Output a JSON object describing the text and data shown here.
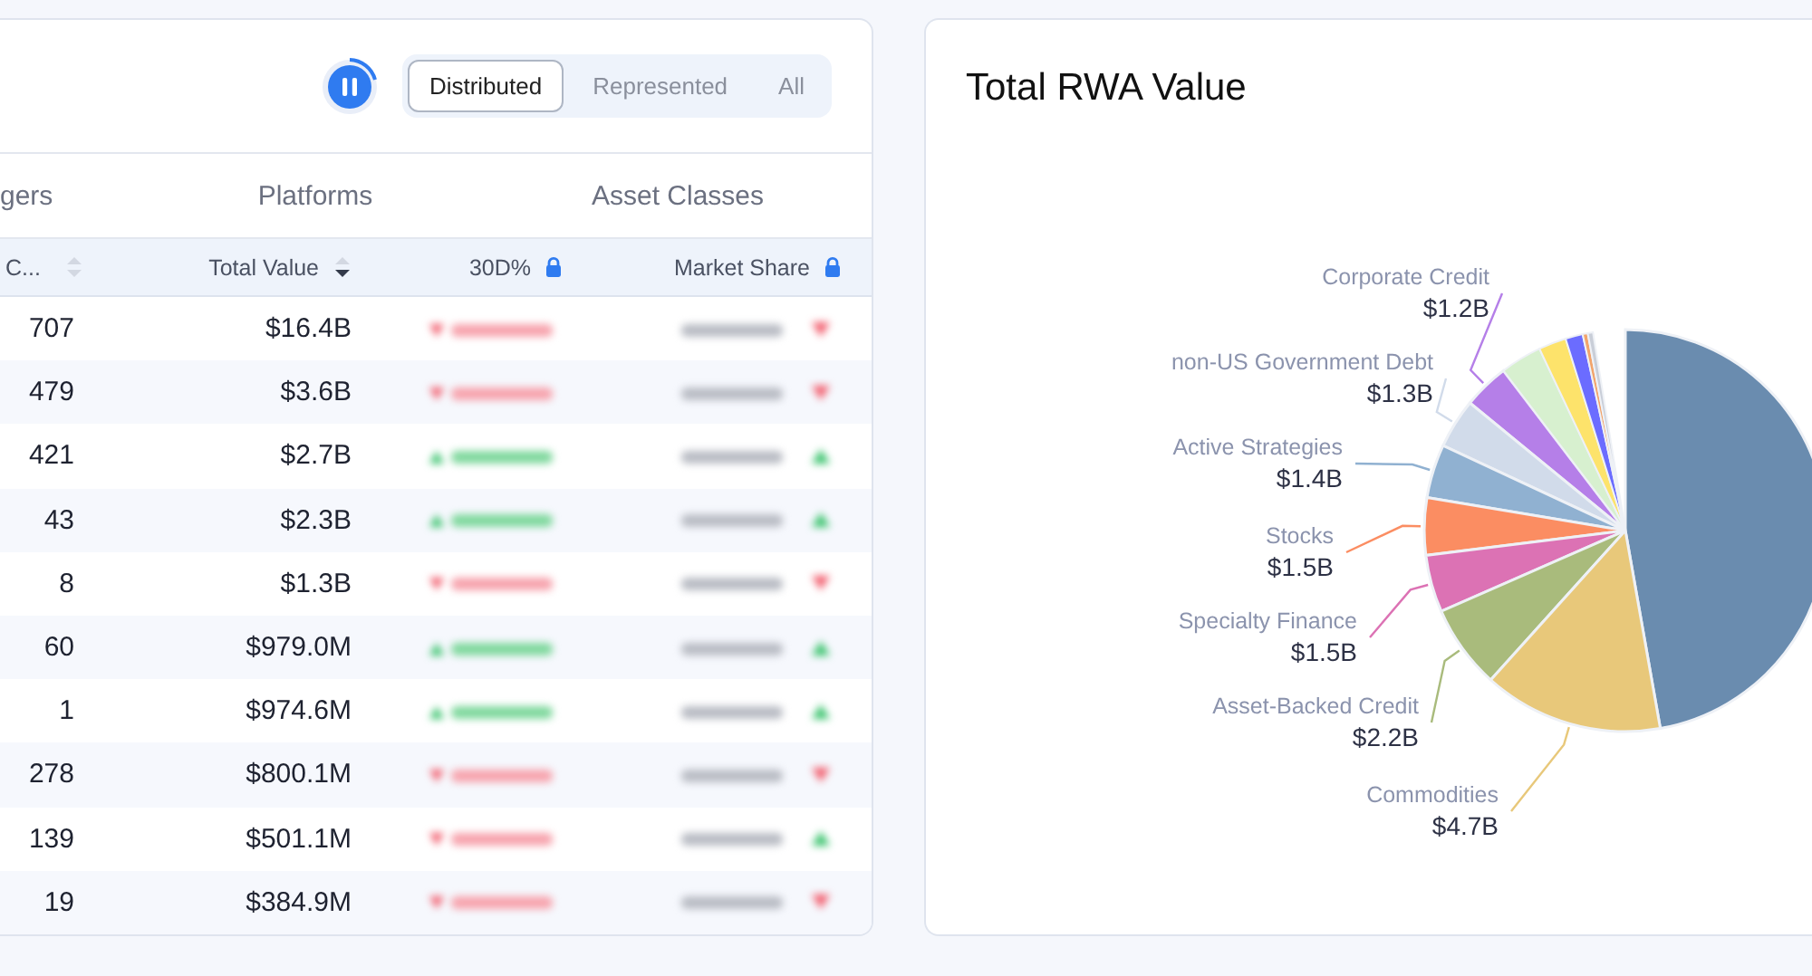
{
  "controls": {
    "segments": [
      {
        "label": "Distributed",
        "selected": true
      },
      {
        "label": "Represented",
        "selected": false
      },
      {
        "label": "All",
        "selected": false
      }
    ],
    "playing": true
  },
  "tabs": [
    {
      "label": "gers"
    },
    {
      "label": "Platforms"
    },
    {
      "label": "Asset Classes"
    }
  ],
  "table": {
    "columns": [
      {
        "label": "C...",
        "sorted": false,
        "locked": false
      },
      {
        "label": "Total Value",
        "sorted": true,
        "locked": false
      },
      {
        "label": "30D%",
        "locked": true
      },
      {
        "label": "Market Share",
        "locked": true
      }
    ],
    "rows": [
      {
        "count": "707",
        "total_value": "$16.4B",
        "change_rising": false,
        "share_rising": false
      },
      {
        "count": "479",
        "total_value": "$3.6B",
        "change_rising": false,
        "share_rising": false
      },
      {
        "count": "421",
        "total_value": "$2.7B",
        "change_rising": true,
        "share_rising": true
      },
      {
        "count": "43",
        "total_value": "$2.3B",
        "change_rising": true,
        "share_rising": true
      },
      {
        "count": "8",
        "total_value": "$1.3B",
        "change_rising": false,
        "share_rising": false
      },
      {
        "count": "60",
        "total_value": "$979.0M",
        "change_rising": true,
        "share_rising": true
      },
      {
        "count": "1",
        "total_value": "$974.6M",
        "change_rising": true,
        "share_rising": true
      },
      {
        "count": "278",
        "total_value": "$800.1M",
        "change_rising": false,
        "share_rising": false
      },
      {
        "count": "139",
        "total_value": "$501.1M",
        "change_rising": false,
        "share_rising": true
      },
      {
        "count": "19",
        "total_value": "$384.9M",
        "change_rising": false,
        "share_rising": false
      }
    ]
  },
  "chart_panel": {
    "title": "Total RWA Value",
    "pie_labels": [
      {
        "name": "Corporate Credit",
        "value": "$1.2B",
        "color": "#b57fe8"
      },
      {
        "name": "non-US Government Debt",
        "value": "$1.3B",
        "color": "#d1dbea"
      },
      {
        "name": "Active Strategies",
        "value": "$1.4B",
        "color": "#90b1d1"
      },
      {
        "name": "Stocks",
        "value": "$1.5B",
        "color": "#fb8d62"
      },
      {
        "name": "Specialty Finance",
        "value": "$1.5B",
        "color": "#dc72b4"
      },
      {
        "name": "Asset-Backed Credit",
        "value": "$2.2B",
        "color": "#a9bb7c"
      },
      {
        "name": "Commodities",
        "value": "$4.7B",
        "color": "#e8c87a"
      }
    ]
  }
}
